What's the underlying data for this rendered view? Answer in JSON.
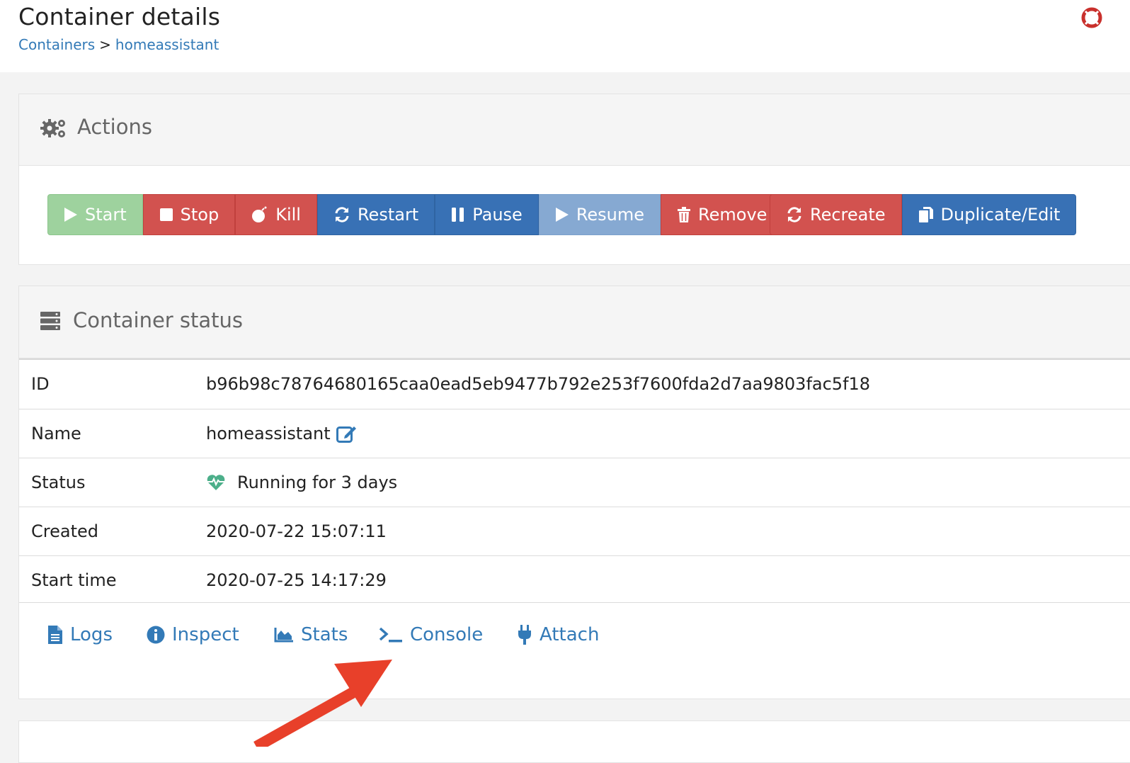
{
  "header": {
    "title": "Container details",
    "breadcrumb": {
      "parent": "Containers",
      "separator": ">",
      "current": "homeassistant"
    }
  },
  "actions": {
    "title": "Actions",
    "buttons": {
      "start": "Start",
      "stop": "Stop",
      "kill": "Kill",
      "restart": "Restart",
      "pause": "Pause",
      "resume": "Resume",
      "remove": "Remove",
      "recreate": "Recreate",
      "duplicate": "Duplicate/Edit"
    }
  },
  "status": {
    "title": "Container status",
    "rows": [
      {
        "label": "ID",
        "value": "b96b98c78764680165caa0ead5eb9477b792e253f7600fda2d7aa9803fac5f18"
      },
      {
        "label": "Name",
        "value": "homeassistant"
      },
      {
        "label": "Status",
        "value": "Running for 3 days"
      },
      {
        "label": "Created",
        "value": "2020-07-22 15:07:11"
      },
      {
        "label": "Start time",
        "value": "2020-07-25 14:17:29"
      }
    ],
    "links": {
      "logs": "Logs",
      "inspect": "Inspect",
      "stats": "Stats",
      "console": "Console",
      "attach": "Attach"
    }
  },
  "colors": {
    "link": "#337ab7",
    "danger": "#d2524f",
    "primary": "#3871b5",
    "success_disabled": "#9ed29e",
    "primary_disabled": "#86a9d2",
    "status_ok": "#4caf8a",
    "arrow": "#e8402a"
  }
}
